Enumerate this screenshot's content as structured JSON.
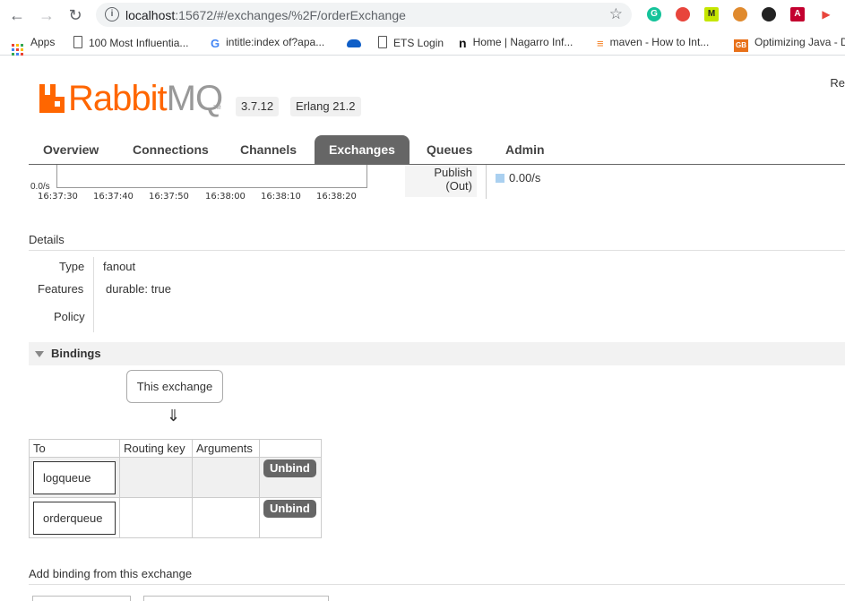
{
  "browser": {
    "url_host": "localhost",
    "url_rest": ":15672/#/exchanges/%2F/orderExchange",
    "bookmarks": [
      {
        "label": "Apps"
      },
      {
        "label": "100 Most Influentia..."
      },
      {
        "label": "intitle:index of?apa..."
      },
      {
        "label": ""
      },
      {
        "label": "ETS Login"
      },
      {
        "label": "Home | Nagarro Inf..."
      },
      {
        "label": "maven - How to Int..."
      },
      {
        "label": "Optimizing Java - D"
      }
    ],
    "extension_colors": [
      "#15c39a",
      "#e8453c",
      "#222222",
      "#e08a2e",
      "#222222",
      "#c3002f",
      "#e8453c"
    ]
  },
  "header": {
    "logo_brand": "Rabbit",
    "logo_mq": "MQ",
    "logo_tm": "TM",
    "version": "3.7.12",
    "erlang": "Erlang 21.2",
    "top_right": "Re"
  },
  "tabs": [
    {
      "label": "Overview",
      "active": false
    },
    {
      "label": "Connections",
      "active": false
    },
    {
      "label": "Channels",
      "active": false
    },
    {
      "label": "Exchanges",
      "active": true
    },
    {
      "label": "Queues",
      "active": false
    },
    {
      "label": "Admin",
      "active": false
    }
  ],
  "chart": {
    "y_label": "0.0/s",
    "x_ticks": [
      "16:37:30",
      "16:37:40",
      "16:37:50",
      "16:38:00",
      "16:38:10",
      "16:38:20"
    ],
    "publish_label_1": "Publish",
    "publish_label_2": "(Out)",
    "publish_value": "0.00/s",
    "publish_color": "#aad0f0"
  },
  "details": {
    "heading": "Details",
    "type_label": "Type",
    "type_value": "fanout",
    "features_label": "Features",
    "features_key": "durable:",
    "features_value": "true",
    "policy_label": "Policy"
  },
  "bindings": {
    "heading": "Bindings",
    "this_exchange": "This exchange",
    "arrow": "⇓",
    "columns": [
      "To",
      "Routing key",
      "Arguments",
      ""
    ],
    "rows": [
      {
        "to": "logqueue",
        "routing_key": "",
        "arguments": "",
        "action": "Unbind"
      },
      {
        "to": "orderqueue",
        "routing_key": "",
        "arguments": "",
        "action": "Unbind"
      }
    ]
  },
  "add_binding": {
    "heading": "Add binding from this exchange"
  }
}
